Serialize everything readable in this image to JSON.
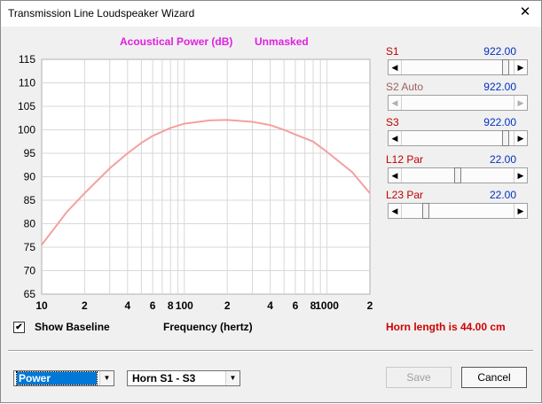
{
  "window": {
    "title": "Transmission Line Loudspeaker Wizard",
    "close_glyph": "✕"
  },
  "chart": {
    "title_left": "Acoustical Power (dB)",
    "title_right": "Unmasked",
    "xlabel": "Frequency (hertz)"
  },
  "chart_data": {
    "type": "line",
    "title": "Acoustical Power (dB)   Unmasked",
    "xlabel": "Frequency (hertz)",
    "ylabel": "",
    "xscale": "log",
    "xlim": [
      10,
      2000
    ],
    "ylim": [
      65,
      115
    ],
    "x_tick_labels": [
      "10",
      "2",
      "4",
      "6",
      "8",
      "100",
      "2",
      "4",
      "6",
      "8",
      "1000",
      "2"
    ],
    "y_tick_labels": [
      "115",
      "110",
      "105",
      "100",
      "95",
      "90",
      "85",
      "80",
      "75",
      "70",
      "65"
    ],
    "grid": true,
    "series": [
      {
        "color": "#f4a0a0",
        "x": [
          10,
          15,
          20,
          30,
          40,
          50,
          60,
          80,
          100,
          150,
          200,
          300,
          400,
          500,
          600,
          800,
          1000,
          1500,
          2000
        ],
        "y": [
          75.5,
          82.5,
          86.5,
          91.8,
          95.0,
          97.2,
          98.7,
          100.4,
          101.3,
          102.0,
          102.1,
          101.7,
          101.0,
          100.0,
          99.0,
          97.5,
          95.3,
          91.0,
          86.5
        ]
      }
    ]
  },
  "sliders": [
    {
      "label": "S1",
      "value": "922.00",
      "enabled": true,
      "fraction": 0.95
    },
    {
      "label": "S2  Auto",
      "value": "922.00",
      "enabled": false,
      "fraction": null
    },
    {
      "label": "S3",
      "value": "922.00",
      "enabled": true,
      "fraction": 0.95
    },
    {
      "label": "L12  Par",
      "value": "22.00",
      "enabled": true,
      "fraction": 0.5
    },
    {
      "label": "L23  Par",
      "value": "22.00",
      "enabled": true,
      "fraction": 0.2
    }
  ],
  "baseline": {
    "checked": true,
    "check_glyph": "✔",
    "label": "Show Baseline"
  },
  "horn_length": "Horn length is 44.00 cm",
  "plot_select": {
    "value": "Power"
  },
  "segment_select": {
    "value": "Horn S1 - S3"
  },
  "buttons": {
    "save": "Save",
    "cancel": "Cancel"
  }
}
